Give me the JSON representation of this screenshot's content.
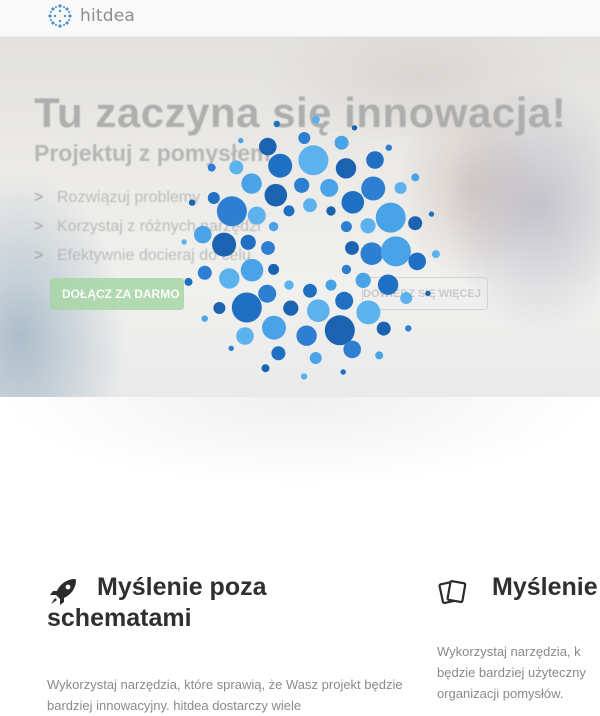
{
  "app": {
    "brand_name": "hitdea",
    "accent_color": "#2e7fd1",
    "logo_icon": "burst-logo-icon"
  },
  "hero": {
    "title": "Tu zaczyna się innowacja!",
    "subtitle": "Projektuj z pomysłem",
    "features": [
      {
        "label": "Rozwiązuj problemy"
      },
      {
        "label": "Korzystaj z różnych narzędzi"
      },
      {
        "label": "Efektywnie docieraj do celu"
      }
    ],
    "join_button": "DOŁĄCZ ZA DARMO",
    "more_button": "DOWIEDZ SIĘ WIĘCEJ",
    "join_color": "#8fd08c"
  },
  "columns": [
    {
      "icon": "rocket-icon",
      "title": "Myślenie poza schematami",
      "text": "Wykorzystaj narzędzia, które sprawią, że Wasz projekt będzie bardziej innowacyjny. hitdea dostarczy wiele"
    },
    {
      "icon": "cards-icon",
      "title": "Myślenie",
      "text_lines": [
        "Wykorzystaj narzędzia, k",
        "będzie bardziej użyteczny",
        "organizacji pomysłów."
      ]
    }
  ]
}
